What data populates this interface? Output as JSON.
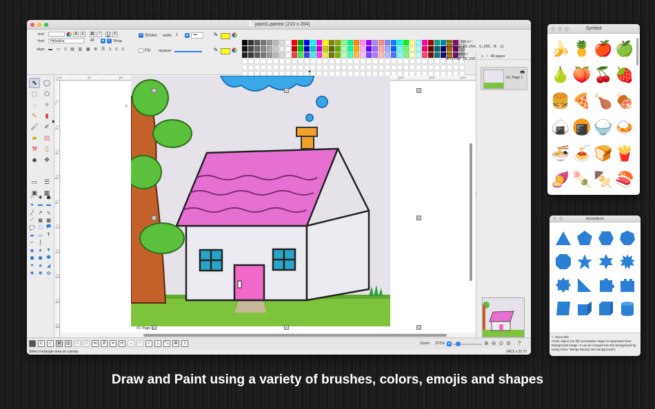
{
  "main_window": {
    "title": "paint1.paintsr (210 x 204)",
    "text_label": "text",
    "font_label": "font",
    "font_value": "Helvetica",
    "font_size": "40",
    "wrap_label": "Wrap",
    "align_label": "align",
    "stroke_label": "Stroke:",
    "width_label": "width",
    "width_value": "1",
    "fill_label": "Fill:",
    "opacity_value": "opaque",
    "stroke_color_label": "Stroke color:",
    "stroke_color_value": "#FEFA02 [R:254, G:250, B:  2]",
    "fill_color_label": "Fill color:",
    "fill_color_value": "#FFFF00 [R:255, G:255, B:  0]",
    "page_label": "#1: Page 1",
    "canvas_y_marker": "y",
    "canvas_x_marker": "x"
  },
  "ruler": {
    "h_ticks": [
      "-40",
      "0",
      "20",
      "40",
      "60",
      "80",
      "100",
      "120",
      "140",
      "160",
      "180",
      "200",
      "220",
      "240"
    ],
    "v_ticks": [
      "0",
      "20",
      "40",
      "60",
      "80",
      "100",
      "120",
      "140",
      "160",
      "180",
      "200"
    ]
  },
  "pages_panel": {
    "header": "All pages",
    "page_caption": "#1: Page 1"
  },
  "bottom_bar": {
    "zoom_label": "Zoom",
    "zoom_value": "371%",
    "help": "?"
  },
  "status": {
    "left": "Select rectangle area on canvas",
    "right": "145.5 x 22.72"
  },
  "symbol_window": {
    "title": "Symbol",
    "emojis": [
      "🍌",
      "🍍",
      "🍎",
      "🍏",
      "🍐",
      "🍑",
      "🍒",
      "🍓",
      "🍔",
      "🍕",
      "🍗",
      "🍖",
      "🍙",
      "🍘",
      "🍚",
      "🍛",
      "🍜",
      "🍝",
      "🍞",
      "🍟",
      "🍠",
      "🍡",
      "🍢",
      "🍣"
    ]
  },
  "annotation_window": {
    "title": "Annotations",
    "show_title_label": "Show title",
    "description": "Circle object (no fill) (Annotation object is separated from background image. It can be merged into the background by using menu \"Merge Item(s) into background\")"
  },
  "colors": {
    "accent_blue": "#2a7de1",
    "shape_blue": "#2b7fd4",
    "stroke_swatch": "#FEFA02",
    "fill_swatch": "#FFFF00"
  },
  "caption": "Draw and Paint using a variety of brushes, colors, emojis and shapes"
}
